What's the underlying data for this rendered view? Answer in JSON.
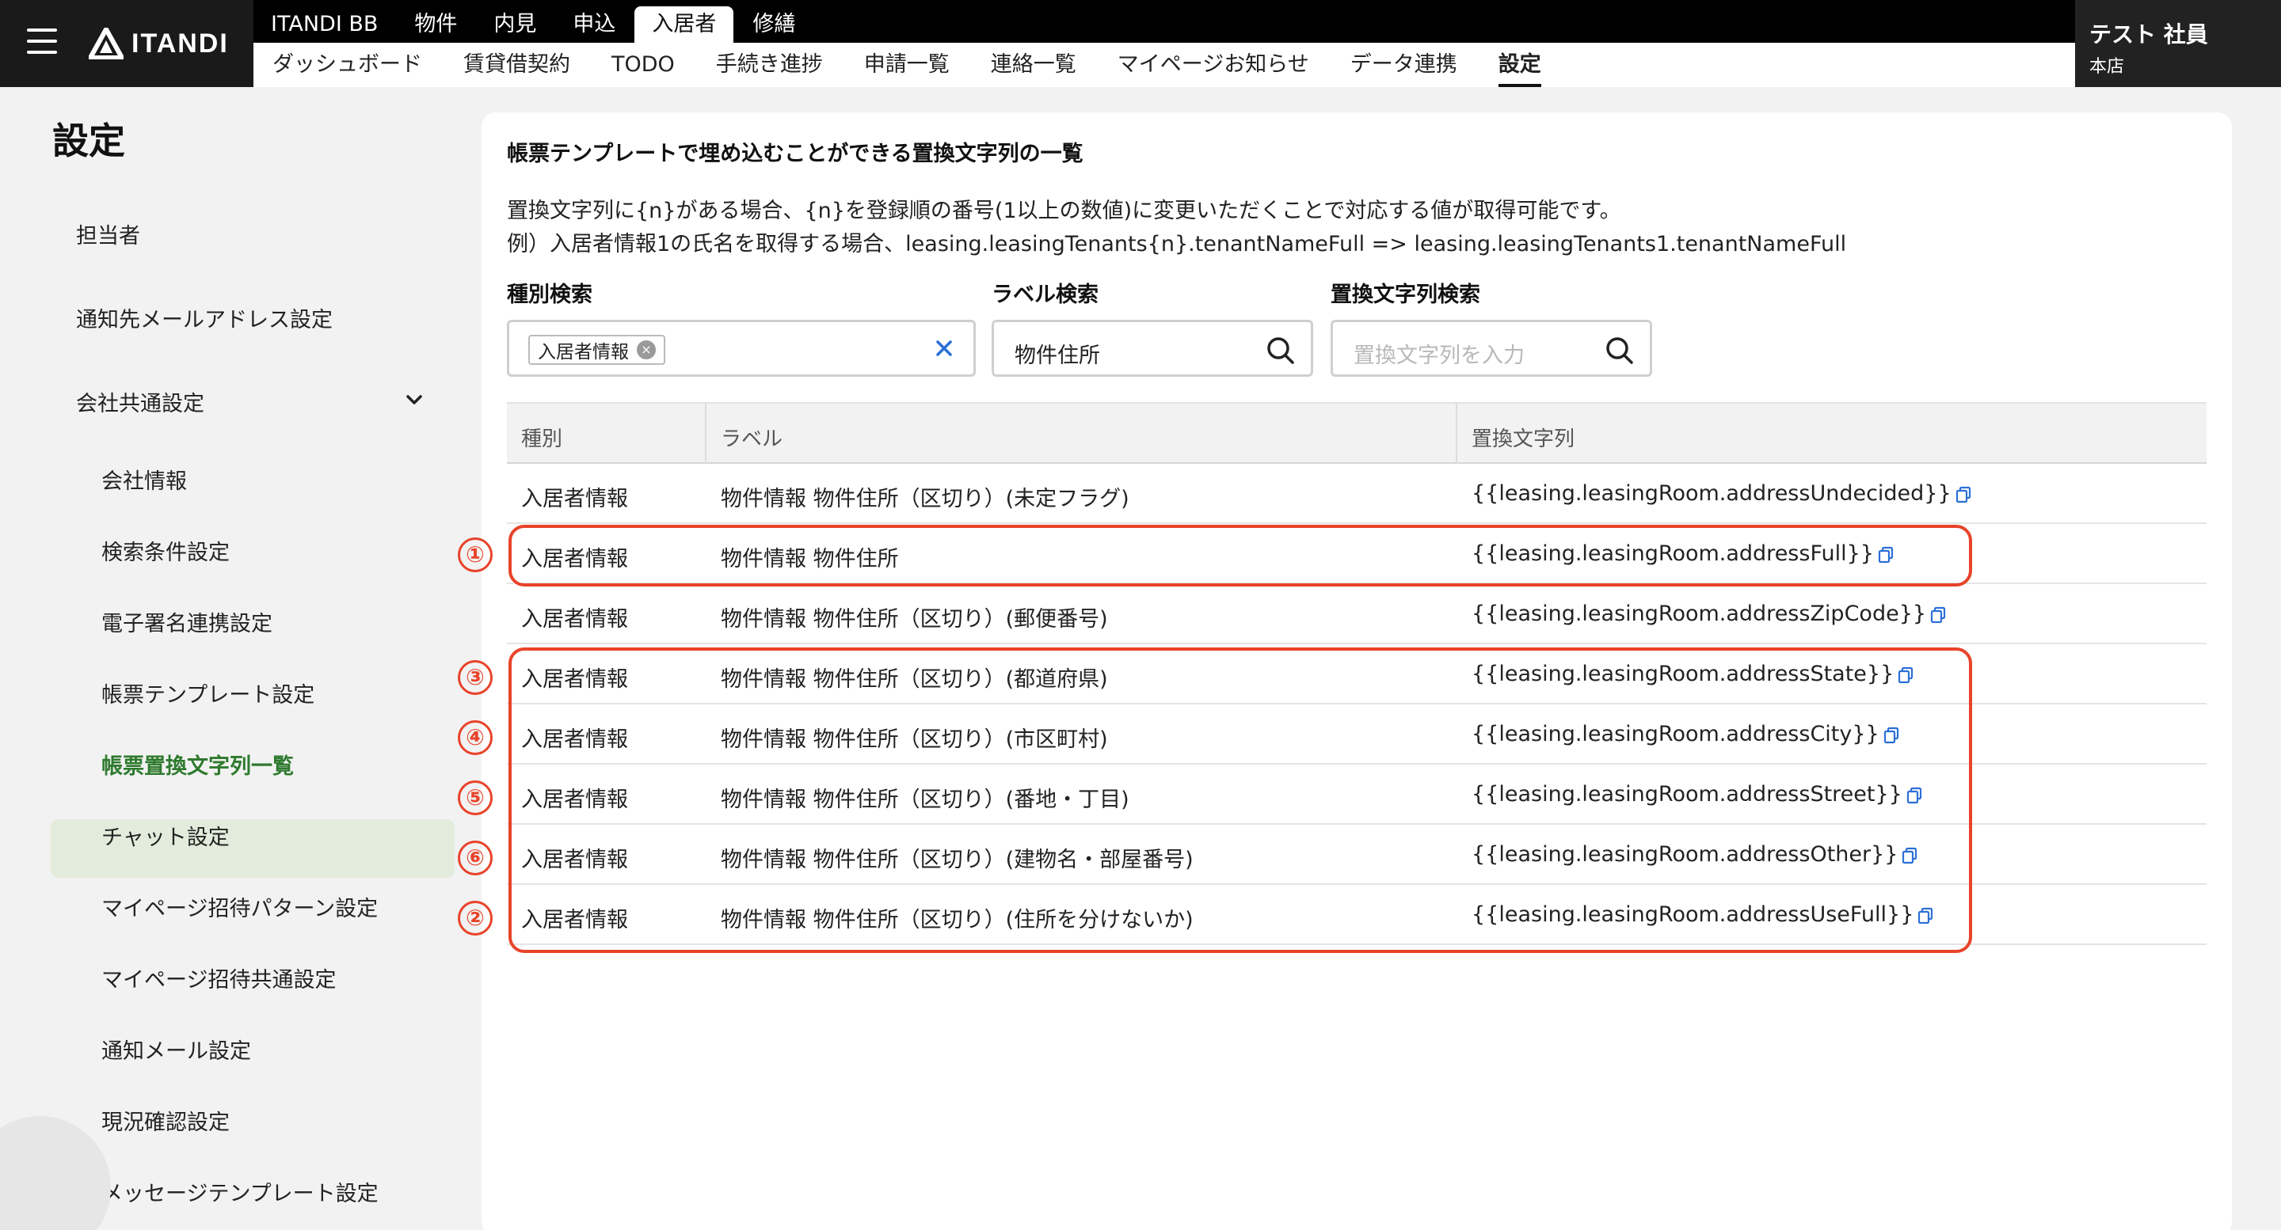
{
  "header": {
    "logo_text": "ITANDI",
    "top_tabs": [
      "ITANDI BB",
      "物件",
      "内見",
      "申込",
      "入居者",
      "修繕"
    ],
    "active_top_tab": "入居者",
    "sub_tabs": [
      "ダッシュボード",
      "賃貸借契約",
      "TODO",
      "手続き進捗",
      "申請一覧",
      "連絡一覧",
      "マイページお知らせ",
      "データ連携",
      "設定"
    ],
    "active_sub_tab": "設定",
    "user_name": "テスト 社員",
    "user_branch": "本店"
  },
  "sidebar": {
    "title": "設定",
    "items": [
      {
        "label": "担当者"
      },
      {
        "label": "通知先メールアドレス設定"
      },
      {
        "label": "会社共通設定"
      },
      {
        "label": "会社情報"
      },
      {
        "label": "検索条件設定"
      },
      {
        "label": "電子署名連携設定"
      },
      {
        "label": "帳票テンプレート設定"
      },
      {
        "label": "帳票置換文字列一覧"
      },
      {
        "label": "チャット設定"
      },
      {
        "label": "マイページ招待パターン設定"
      },
      {
        "label": "マイページ招待共通設定"
      },
      {
        "label": "通知メール設定"
      },
      {
        "label": "現況確認設定"
      },
      {
        "label": "メッセージテンプレート設定"
      }
    ],
    "active_item": "帳票置換文字列一覧"
  },
  "main": {
    "heading": "帳票テンプレートで埋め込むことができる置換文字列の一覧",
    "desc1": "置換文字列に{n}がある場合、{n}を登録順の番号(1以上の数値)に変更いただくことで対応する値が取得可能です。",
    "desc2": "例）入居者情報1の氏名を取得する場合、leasing.leasingTenants{n}.tenantNameFull => leasing.leasingTenants1.tenantNameFull",
    "filters": {
      "type_label": "種別検索",
      "type_chip": "入居者情報",
      "label_label": "ラベル検索",
      "label_value": "物件住所",
      "string_label": "置換文字列検索",
      "string_placeholder": "置換文字列を入力"
    },
    "table": {
      "columns": [
        "種別",
        "ラベル",
        "置換文字列"
      ],
      "rows": [
        {
          "type": "入居者情報",
          "label": "物件情報 物件住所（区切り）(未定フラグ)",
          "value": "{{leasing.leasingRoom.addressUndecided}}"
        },
        {
          "type": "入居者情報",
          "label": "物件情報 物件住所",
          "value": "{{leasing.leasingRoom.addressFull}}"
        },
        {
          "type": "入居者情報",
          "label": "物件情報 物件住所（区切り）(郵便番号)",
          "value": "{{leasing.leasingRoom.addressZipCode}}"
        },
        {
          "type": "入居者情報",
          "label": "物件情報 物件住所（区切り）(都道府県)",
          "value": "{{leasing.leasingRoom.addressState}}"
        },
        {
          "type": "入居者情報",
          "label": "物件情報 物件住所（区切り）(市区町村)",
          "value": "{{leasing.leasingRoom.addressCity}}"
        },
        {
          "type": "入居者情報",
          "label": "物件情報 物件住所（区切り）(番地・丁目)",
          "value": "{{leasing.leasingRoom.addressStreet}}"
        },
        {
          "type": "入居者情報",
          "label": "物件情報 物件住所（区切り）(建物名・部屋番号)",
          "value": "{{leasing.leasingRoom.addressOther}}"
        },
        {
          "type": "入居者情報",
          "label": "物件情報 物件住所（区切り）(住所を分けないか)",
          "value": "{{leasing.leasingRoom.addressUseFull}}"
        }
      ]
    },
    "annotations": [
      "①",
      "③",
      "④",
      "⑤",
      "⑥",
      "②"
    ]
  },
  "colors": {
    "accent_red": "#e8432a",
    "active_green": "#2e7a2e",
    "header_bg": "#1a1a1a"
  }
}
